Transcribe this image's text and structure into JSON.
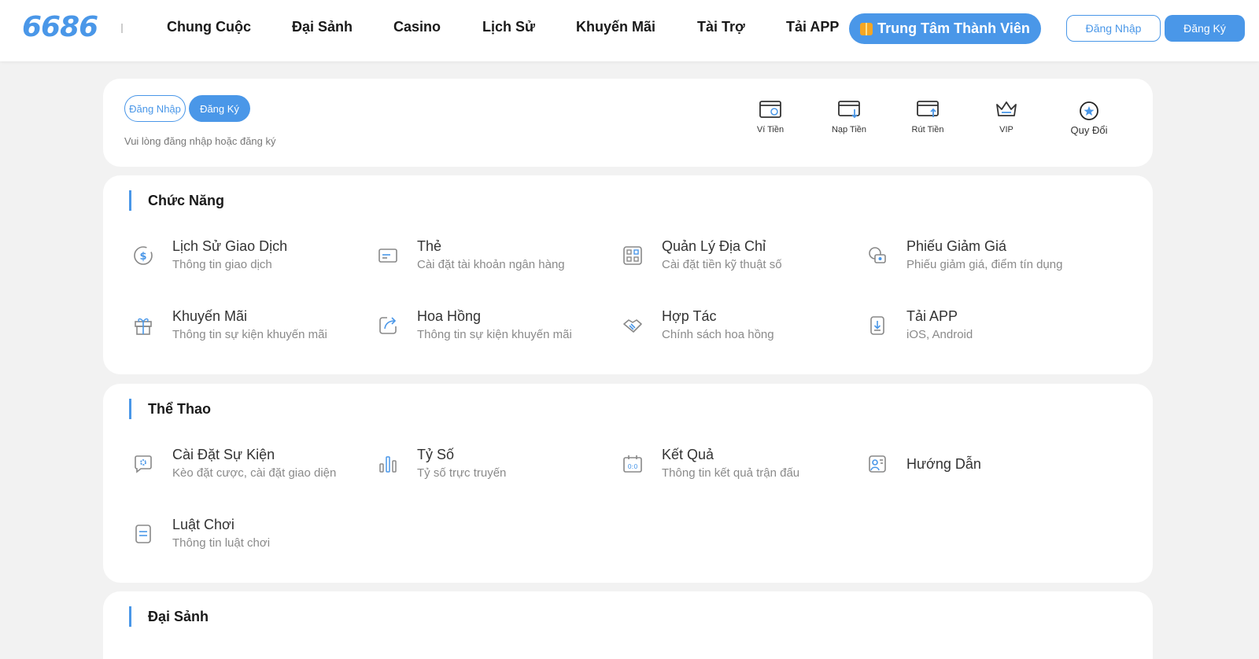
{
  "header": {
    "logo": "6686",
    "nav": [
      "Chung Cuộc",
      "Đại Sảnh",
      "Casino",
      "Lịch Sử",
      "Khuyến Mãi",
      "Tài Trợ",
      "Tải APP"
    ],
    "member_center": "Trung Tâm Thành Viên",
    "login": "Đăng Nhập",
    "register": "Đăng Ký"
  },
  "user_card": {
    "login": "Đăng Nhập",
    "register": "Đăng Ký",
    "hint": "Vui lòng đăng nhập hoặc đăng ký",
    "quick": [
      {
        "label": "Ví Tiền",
        "icon": "wallet-icon"
      },
      {
        "label": "Nạp Tiền",
        "icon": "deposit-icon"
      },
      {
        "label": "Rút Tiền",
        "icon": "withdraw-icon"
      },
      {
        "label": "VIP",
        "icon": "crown-icon"
      },
      {
        "label": "Quy Đổi",
        "icon": "star-circle-icon"
      }
    ]
  },
  "functions": {
    "title": "Chức Năng",
    "items": [
      {
        "title": "Lịch Sử Giao Dịch",
        "sub": "Thông tin giao dịch",
        "icon": "dollar-cycle-icon"
      },
      {
        "title": "Thẻ",
        "sub": "Cài đặt tài khoản ngân hàng",
        "icon": "card-icon"
      },
      {
        "title": "Quản Lý Địa Chỉ",
        "sub": "Cài đặt tiền kỹ thuật số",
        "icon": "qr-icon"
      },
      {
        "title": "Phiếu Giảm Giá",
        "sub": "Phiếu giảm giá, điểm tín dụng",
        "icon": "coupon-icon"
      },
      {
        "title": "Khuyến Mãi",
        "sub": "Thông tin sự kiện khuyến mãi",
        "icon": "gift-icon"
      },
      {
        "title": "Hoa Hồng",
        "sub": "Thông tin sự kiện khuyến mãi",
        "icon": "share-icon"
      },
      {
        "title": "Hợp Tác",
        "sub": "Chính sách hoa hồng",
        "icon": "handshake-icon"
      },
      {
        "title": "Tải APP",
        "sub": "iOS, Android",
        "icon": "download-icon"
      }
    ]
  },
  "sports": {
    "title": "Thể Thao",
    "items": [
      {
        "title": "Cài Đặt Sự Kiện",
        "sub": "Kèo đặt cược, cài đặt giao diện",
        "icon": "chat-gear-icon"
      },
      {
        "title": "Tỷ Số",
        "sub": "Tỷ số trực truyến",
        "icon": "bar-chart-icon"
      },
      {
        "title": "Kết Quả",
        "sub": "Thông tin kết quả trận đấu",
        "icon": "scoreboard-icon"
      },
      {
        "title": "Hướng Dẫn",
        "sub": "",
        "icon": "guide-icon"
      },
      {
        "title": "Luật Chơi",
        "sub": "Thông tin luật chơi",
        "icon": "rules-icon"
      }
    ]
  },
  "lobby": {
    "title": "Đại Sảnh"
  }
}
